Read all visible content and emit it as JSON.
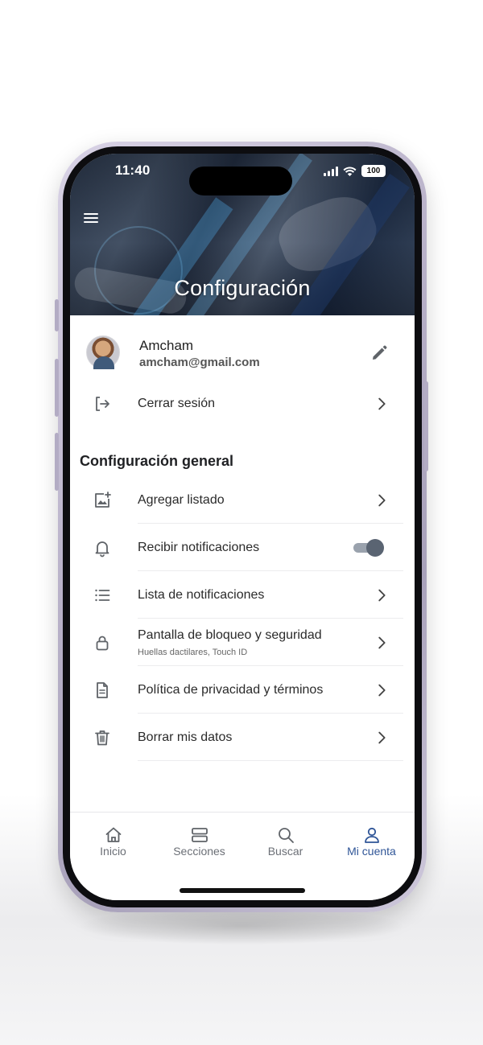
{
  "status_bar": {
    "time": "11:40",
    "battery": "100"
  },
  "header": {
    "title": "Configuración"
  },
  "profile": {
    "name": "Amcham",
    "email": "amcham@gmail.com"
  },
  "account_items": [
    {
      "label": "Cerrar sesión",
      "icon": "logout-icon"
    }
  ],
  "general": {
    "title": "Configuración general",
    "items": [
      {
        "label": "Agregar listado",
        "icon": "add-photo-icon",
        "control": "chevron"
      },
      {
        "label": "Recibir notificaciones",
        "icon": "bell-icon",
        "control": "toggle",
        "toggle_on": true
      },
      {
        "label": "Lista de notificaciones",
        "icon": "list-icon",
        "control": "chevron"
      },
      {
        "label": "Pantalla de bloqueo y seguridad",
        "sublabel": "Huellas dactilares, Touch ID",
        "icon": "lock-icon",
        "control": "chevron"
      },
      {
        "label": "Política de privacidad y términos",
        "icon": "document-icon",
        "control": "chevron"
      },
      {
        "label": "Borrar mis datos",
        "icon": "trash-icon",
        "control": "chevron"
      }
    ]
  },
  "bottom_nav": {
    "items": [
      {
        "label": "Inicio",
        "icon": "home-icon",
        "active": false
      },
      {
        "label": "Secciones",
        "icon": "sections-icon",
        "active": false
      },
      {
        "label": "Buscar",
        "icon": "search-icon",
        "active": false
      },
      {
        "label": "Mi cuenta",
        "icon": "user-icon",
        "active": true
      }
    ]
  },
  "colors": {
    "accent": "#2f5597",
    "icon_gray": "#5f6368",
    "text": "#2a2a2a",
    "toggle_knob": "#5a6472"
  }
}
